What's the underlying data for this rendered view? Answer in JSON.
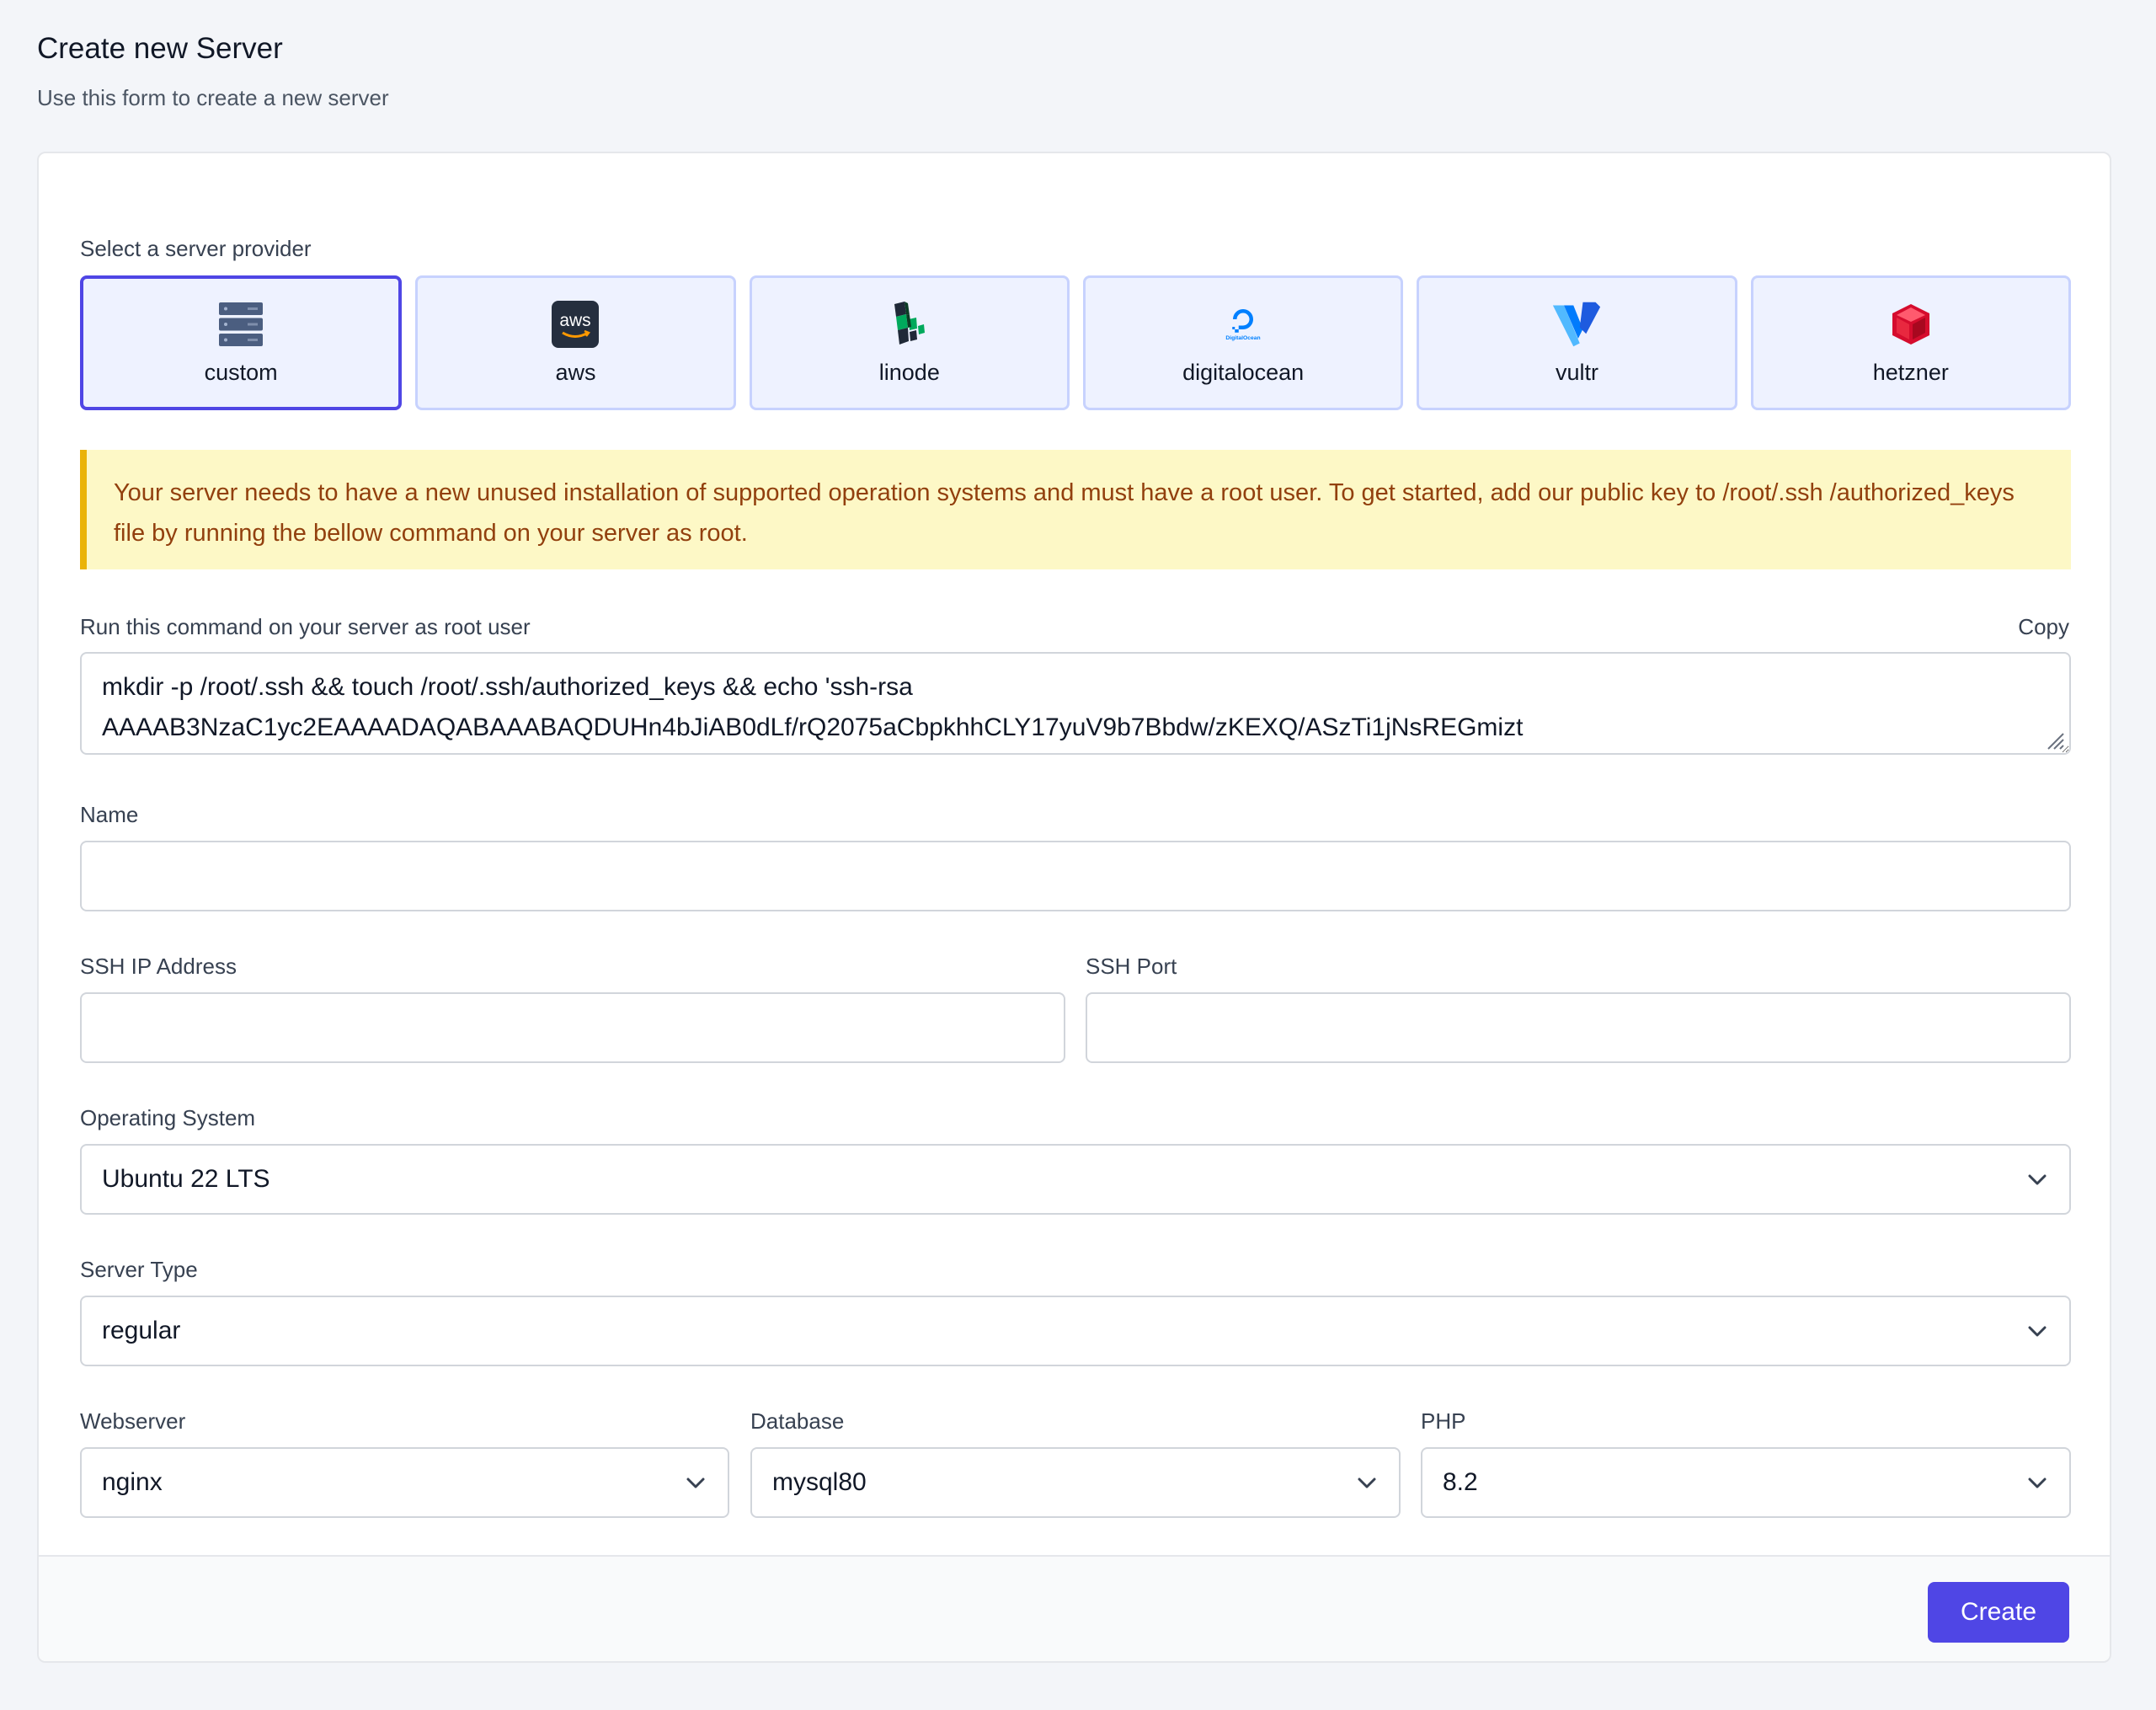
{
  "header": {
    "title": "Create new Server",
    "subtitle": "Use this form to create a new server"
  },
  "provider_section": {
    "label": "Select a server provider",
    "selected": "custom",
    "providers": [
      {
        "id": "custom",
        "label": "custom",
        "icon": "server-rack-icon"
      },
      {
        "id": "aws",
        "label": "aws",
        "icon": "aws-logo-icon"
      },
      {
        "id": "linode",
        "label": "linode",
        "icon": "linode-logo-icon"
      },
      {
        "id": "digitalocean",
        "label": "digitalocean",
        "icon": "digitalocean-logo-icon",
        "logo_text": "DigitalOcean"
      },
      {
        "id": "vultr",
        "label": "vultr",
        "icon": "vultr-logo-icon"
      },
      {
        "id": "hetzner",
        "label": "hetzner",
        "icon": "hetzner-logo-icon"
      }
    ]
  },
  "alert": {
    "text": "Your server needs to have a new unused installation of supported operation systems and must have a root user. To get started, add our public key to /root/.ssh /authorized_keys file by running the bellow command on your server as root."
  },
  "command": {
    "label": "Run this command on your server as root user",
    "copy_label": "Copy",
    "value": "mkdir -p /root/.ssh && touch /root/.ssh/authorized_keys && echo 'ssh-rsa AAAAB3NzaC1yc2EAAAADAQABAAABAQDUHn4bJiAB0dLf/rQ2075aCbpkhhCLY17yuV9b7Bbdw/zKEXQ/ASzTi1jNsREGmizt"
  },
  "fields": {
    "name": {
      "label": "Name",
      "value": ""
    },
    "ssh_ip": {
      "label": "SSH IP Address",
      "value": ""
    },
    "ssh_port": {
      "label": "SSH Port",
      "value": ""
    },
    "os": {
      "label": "Operating System",
      "value": "Ubuntu 22 LTS"
    },
    "server_type": {
      "label": "Server Type",
      "value": "regular"
    },
    "webserver": {
      "label": "Webserver",
      "value": "nginx"
    },
    "database": {
      "label": "Database",
      "value": "mysql80"
    },
    "php": {
      "label": "PHP",
      "value": "8.2"
    }
  },
  "footer": {
    "create_label": "Create"
  },
  "colors": {
    "accent": "#4f46e5",
    "alert_bg": "#fdf8c6",
    "alert_text": "#92400e",
    "alert_border": "#eab308"
  }
}
